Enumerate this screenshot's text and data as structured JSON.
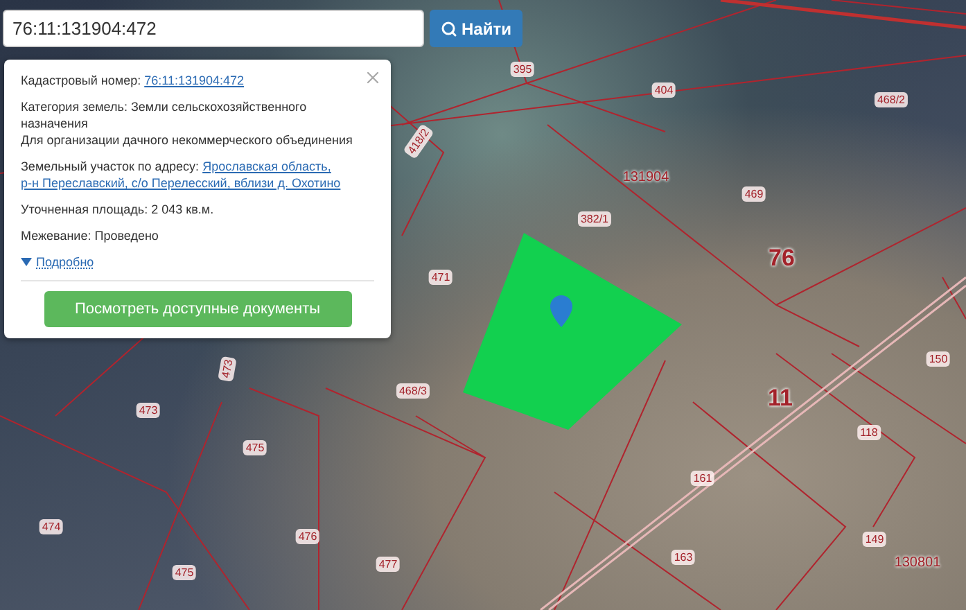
{
  "search": {
    "value": "76:11:131904:472",
    "button": "Найти"
  },
  "popup": {
    "rows": [
      {
        "kind": "link",
        "label": "Кадастровый номер:",
        "value": "76:11:131904:472"
      },
      {
        "kind": "text",
        "label": "Категория земель:",
        "value": "Земли сельскохозяйственного назначения",
        "note": "Для организации дачного некоммерческого объединения"
      },
      {
        "kind": "link",
        "label": "Земельный участок по адресу:",
        "value": [
          "Ярославская область,",
          "р-н Переславский, с/о Перелесский, вблизи д. Охотино"
        ]
      },
      {
        "kind": "text",
        "label": "Уточненная площадь:",
        "value": "2 043 кв.м."
      },
      {
        "kind": "text",
        "label": "Межевание:",
        "value": "Проведено"
      }
    ],
    "details_link": "Подробно",
    "expanded": false,
    "button": "Посмотреть доступные документы"
  },
  "map": {
    "labels": [
      {
        "text": "395",
        "kind": "parcel"
      },
      {
        "text": "404",
        "kind": "parcel"
      },
      {
        "text": "468/2",
        "kind": "parcel"
      },
      {
        "text": "418/2",
        "kind": "parcel"
      },
      {
        "text": "131904",
        "kind": "block"
      },
      {
        "text": "469",
        "kind": "parcel"
      },
      {
        "text": "382/1",
        "kind": "parcel"
      },
      {
        "text": "76",
        "kind": "district"
      },
      {
        "text": "471",
        "kind": "parcel"
      },
      {
        "text": "473",
        "kind": "parcel"
      },
      {
        "text": "473",
        "kind": "parcel"
      },
      {
        "text": "468/3",
        "kind": "parcel"
      },
      {
        "text": "475",
        "kind": "parcel"
      },
      {
        "text": "474",
        "kind": "parcel"
      },
      {
        "text": "476",
        "kind": "parcel"
      },
      {
        "text": "475",
        "kind": "parcel"
      },
      {
        "text": "477",
        "kind": "parcel"
      },
      {
        "text": "11",
        "kind": "district"
      },
      {
        "text": "150",
        "kind": "parcel"
      },
      {
        "text": "118",
        "kind": "parcel"
      },
      {
        "text": "161",
        "kind": "parcel"
      },
      {
        "text": "163",
        "kind": "parcel"
      },
      {
        "text": "149",
        "kind": "parcel"
      },
      {
        "text": "130801",
        "kind": "block"
      }
    ]
  }
}
